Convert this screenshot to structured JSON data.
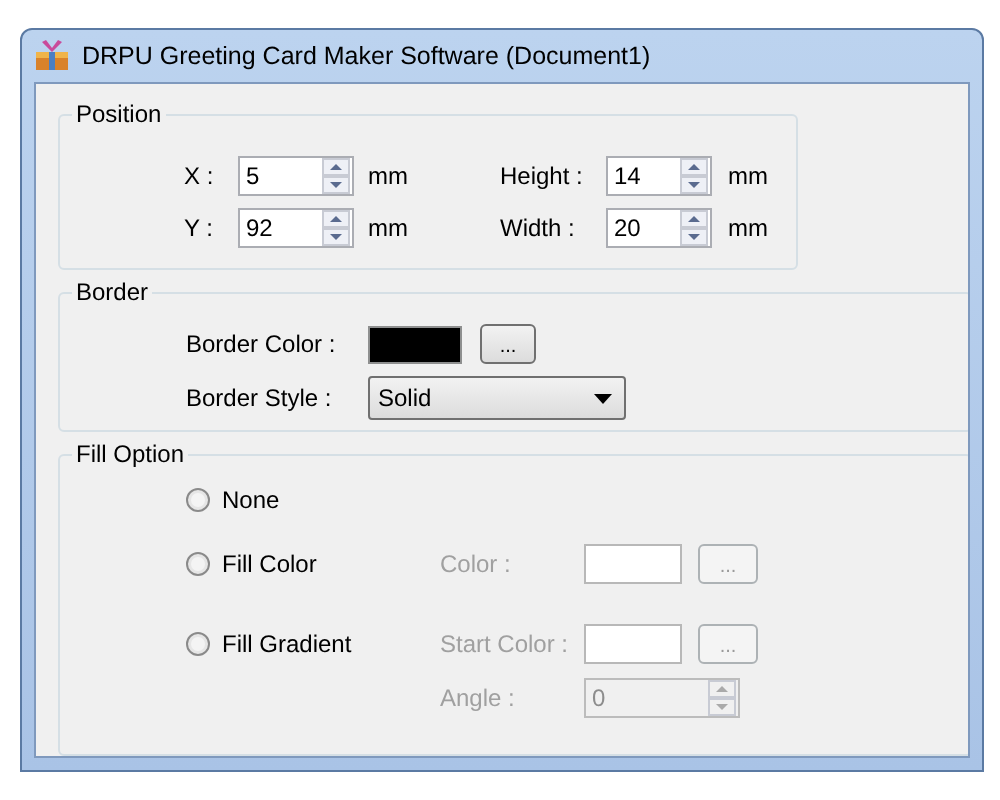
{
  "window": {
    "title": "DRPU Greeting Card Maker Software  (Document1)"
  },
  "position": {
    "title": "Position",
    "fields": [
      {
        "label": "X :",
        "value": "5",
        "unit": "mm"
      },
      {
        "label": "Height :",
        "value": "14",
        "unit": "mm"
      },
      {
        "label": "Y :",
        "value": "92",
        "unit": "mm"
      },
      {
        "label": "Width :",
        "value": "20",
        "unit": "mm"
      }
    ]
  },
  "border": {
    "title": "Border",
    "color_label": "Border Color :",
    "color": "#000000",
    "browse": "...",
    "style_label": "Border Style :",
    "style": "Solid"
  },
  "fill": {
    "title": "Fill Option",
    "disabled": true,
    "options": [
      {
        "label": "None",
        "selected": false
      },
      {
        "label": "Fill Color",
        "selected": false
      },
      {
        "label": "Fill Gradient",
        "selected": false
      }
    ],
    "color_label": "Color :",
    "color_browse": "...",
    "start_label": "Start Color :",
    "start_browse": "...",
    "angle_label": "Angle :",
    "angle": "0"
  }
}
